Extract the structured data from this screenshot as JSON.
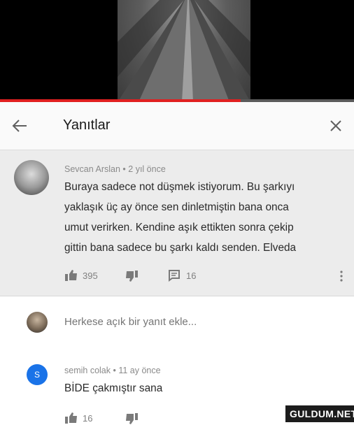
{
  "video": {
    "progress": 0.68
  },
  "header": {
    "title": "Yanıtlar"
  },
  "comment": {
    "author": "Sevcan Arslan",
    "age": "2 yıl önce",
    "text": "Buraya sadece not düşmek istiyorum. Bu şarkıyı\nyaklaşık üç ay önce sen dinletmiştin bana onca\numut verirken. Kendine aşık ettikten sonra çekip\ngittin bana sadece bu şarkı kaldı senden. Elveda",
    "likes": "395",
    "replies": "16"
  },
  "reply_input": {
    "placeholder": "Herkese açık bir yanıt ekle..."
  },
  "reply": {
    "author": "semih colak",
    "age": "11 ay önce",
    "avatar_letter": "S",
    "avatar_color": "#1a73e8",
    "text": "BİDE  çakmıştır sana",
    "likes": "16"
  },
  "watermark": {
    "text": "GULDUM.NET"
  },
  "icons": [
    "back-arrow-icon",
    "close-icon",
    "thumbs-up-icon",
    "thumbs-down-icon",
    "comment-icon",
    "more-vertical-icon"
  ],
  "colors": {
    "progress": "#e02020",
    "highlight_bg": "#ececec",
    "avatar_blue": "#1a73e8"
  }
}
